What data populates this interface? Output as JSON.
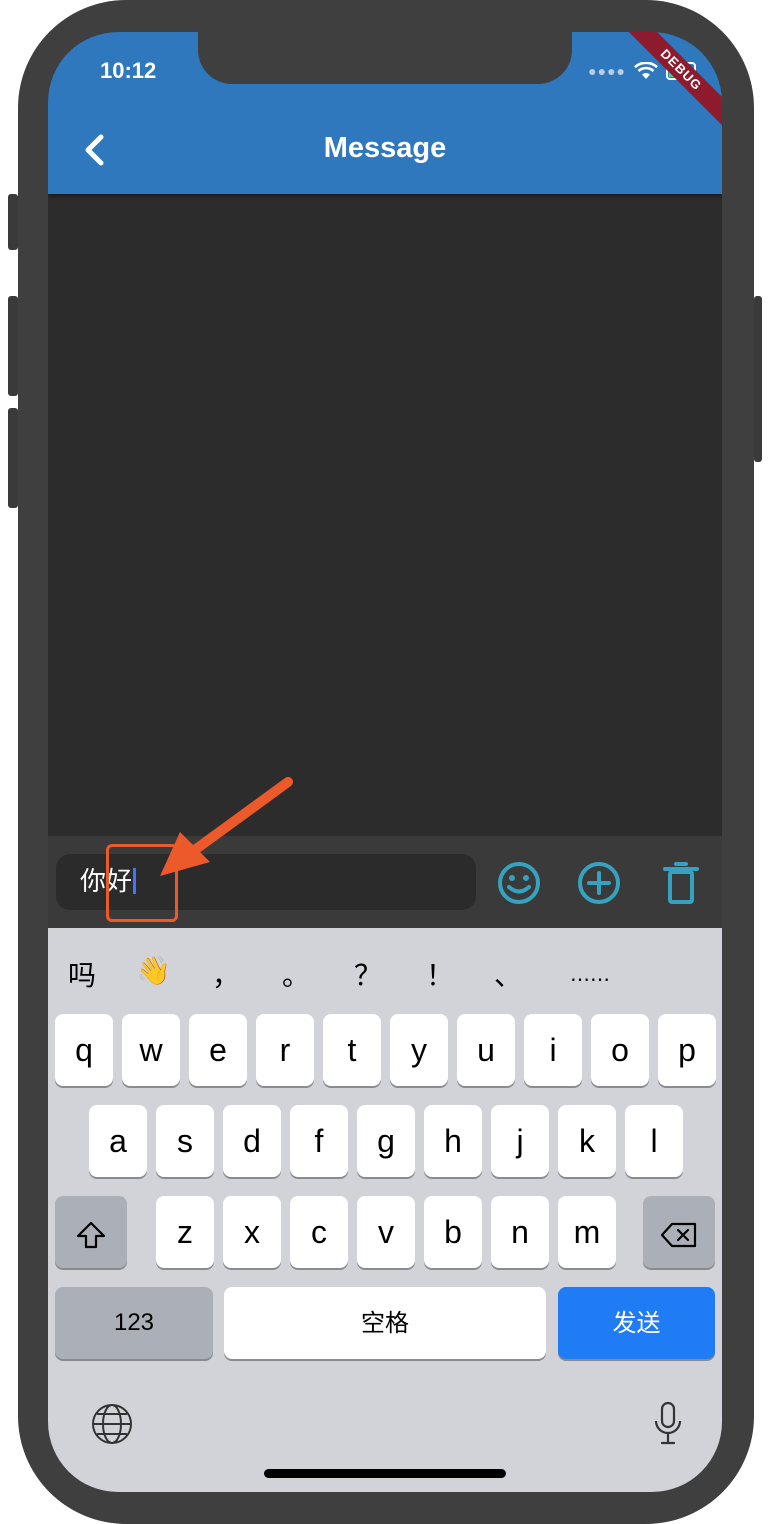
{
  "status_bar": {
    "time": "10:12",
    "debug_label": "DEBUG"
  },
  "header": {
    "title": "Message"
  },
  "composer": {
    "input_value": "你好"
  },
  "keyboard": {
    "candidates": [
      "吗",
      "👋",
      "，",
      "。",
      "？",
      "！",
      "、",
      "……"
    ],
    "row1": [
      "q",
      "w",
      "e",
      "r",
      "t",
      "y",
      "u",
      "i",
      "o",
      "p"
    ],
    "row2": [
      "a",
      "s",
      "d",
      "f",
      "g",
      "h",
      "j",
      "k",
      "l"
    ],
    "row3": [
      "z",
      "x",
      "c",
      "v",
      "b",
      "n",
      "m"
    ],
    "numbers_label": "123",
    "space_label": "空格",
    "send_label": "发送"
  },
  "colors": {
    "app_bar": "#2f78bd",
    "accent_icons": "#35a3c0",
    "send_key": "#1f7cf5",
    "annotation": "#ec5a2c"
  }
}
